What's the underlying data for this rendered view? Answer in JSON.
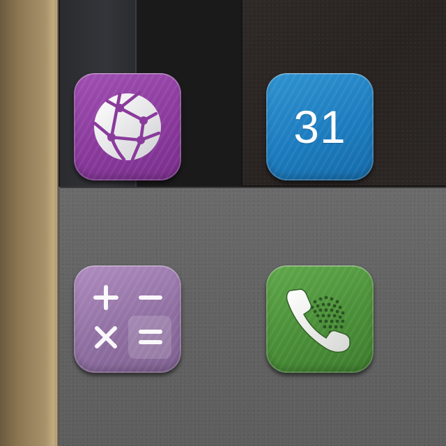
{
  "home_screen": {
    "apps": [
      {
        "id": "browser",
        "icon": "globe-network-icon",
        "color": "#8a3a9c"
      },
      {
        "id": "calendar",
        "icon": "calendar-icon",
        "day_label": "31",
        "color": "#1c7cbf"
      },
      {
        "id": "calculator",
        "icon": "calculator-icon",
        "color": "#9070a2"
      },
      {
        "id": "phone",
        "icon": "phone-handset-icon",
        "color": "#4a8f38"
      }
    ]
  }
}
